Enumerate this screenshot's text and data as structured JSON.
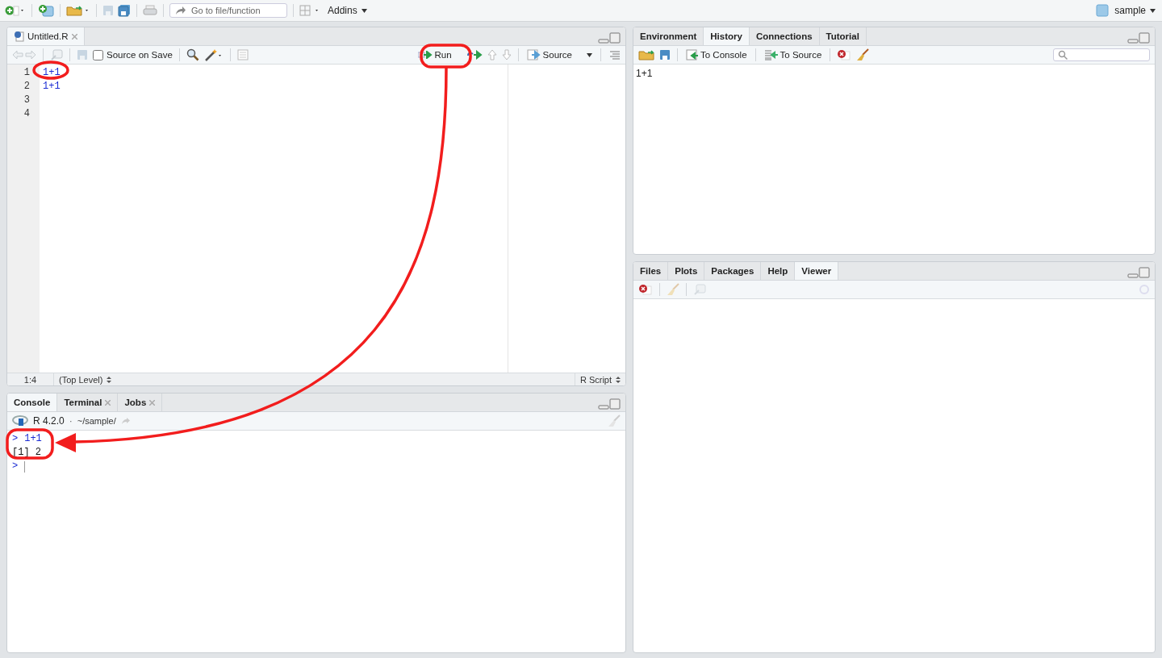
{
  "toolbar": {
    "goto_placeholder": "Go to file/function",
    "addins": "Addins",
    "project": "sample"
  },
  "source": {
    "tabs": [
      {
        "label": "Untitled.R",
        "selected": true
      }
    ],
    "source_on_save": {
      "label": "Source on Save",
      "checked": false
    },
    "run": "Run",
    "source_button": "Source",
    "lines": [
      {
        "number": "1",
        "code": "1+1"
      },
      {
        "number": "2",
        "code": "1+1"
      },
      {
        "number": "3"
      },
      {
        "number": "4"
      }
    ],
    "status": {
      "position": "1:4",
      "scope": "(Top Level)",
      "type": "R Script"
    }
  },
  "console": {
    "tabs": [
      {
        "label": "Console",
        "selected": true,
        "closable": false
      },
      {
        "label": "Terminal",
        "selected": false,
        "closable": true
      },
      {
        "label": "Jobs",
        "selected": false,
        "closable": true
      }
    ],
    "version": "R 4.2.0",
    "separator": "·",
    "path": "~/sample/",
    "lines": [
      {
        "kind": "input",
        "prompt": ">",
        "text": "1+1"
      },
      {
        "kind": "output",
        "text": "[1] 2"
      },
      {
        "kind": "input",
        "prompt": ">"
      }
    ]
  },
  "environment": {
    "tabs": [
      {
        "label": "Environment",
        "selected": false
      },
      {
        "label": "History",
        "selected": true
      },
      {
        "label": "Connections",
        "selected": false
      },
      {
        "label": "Tutorial",
        "selected": false
      }
    ],
    "to_console": "To Console",
    "to_source": "To Source",
    "history": [
      "1+1"
    ]
  },
  "files": {
    "tabs": [
      {
        "label": "Files",
        "selected": false
      },
      {
        "label": "Plots",
        "selected": false
      },
      {
        "label": "Packages",
        "selected": false
      },
      {
        "label": "Help",
        "selected": false
      },
      {
        "label": "Viewer",
        "selected": true
      }
    ]
  }
}
